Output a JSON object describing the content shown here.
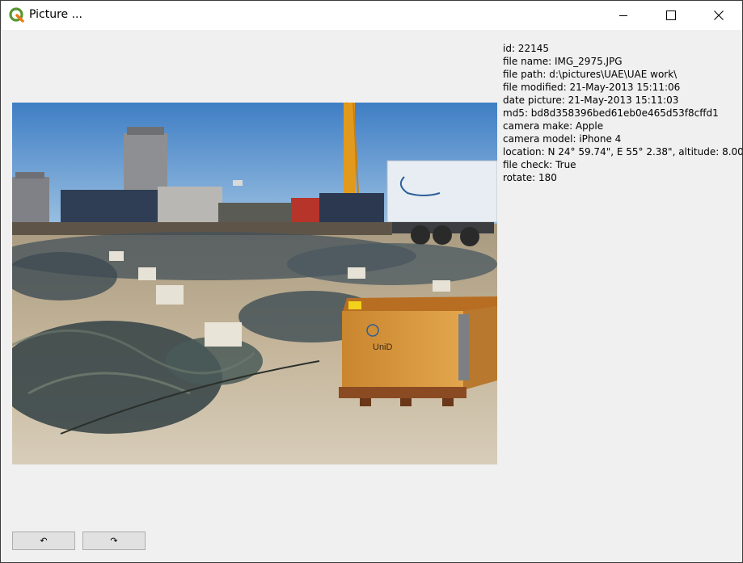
{
  "window": {
    "title": "Picture ...",
    "app_icon": "qgis-logo-icon",
    "controls": {
      "minimize_icon": "minimize-icon",
      "maximize_icon": "maximize-icon",
      "close_icon": "close-icon"
    }
  },
  "photo": {
    "description_icon": "photo-construction-site"
  },
  "metadata": [
    "id:  22145",
    "file name: IMG_2975.JPG",
    "file path: d:\\pictures\\UAE\\UAE work\\",
    "file modified: 21-May-2013 15:11:06",
    "date picture: 21-May-2013 15:11:03",
    "md5: bd8d358396bed61eb0e465d53f8cffd1",
    "camera make: Apple",
    "camera model: iPhone 4",
    "location: N 24° 59.74\", E 55° 2.38\", altitude: 8.00",
    "file check: True",
    "rotate: 180"
  ],
  "buttons": {
    "rotate_left_icon": "rotate-left-icon",
    "rotate_left_glyph": "↶",
    "rotate_right_icon": "rotate-right-icon",
    "rotate_right_glyph": "↷"
  },
  "box_label": "UniD"
}
